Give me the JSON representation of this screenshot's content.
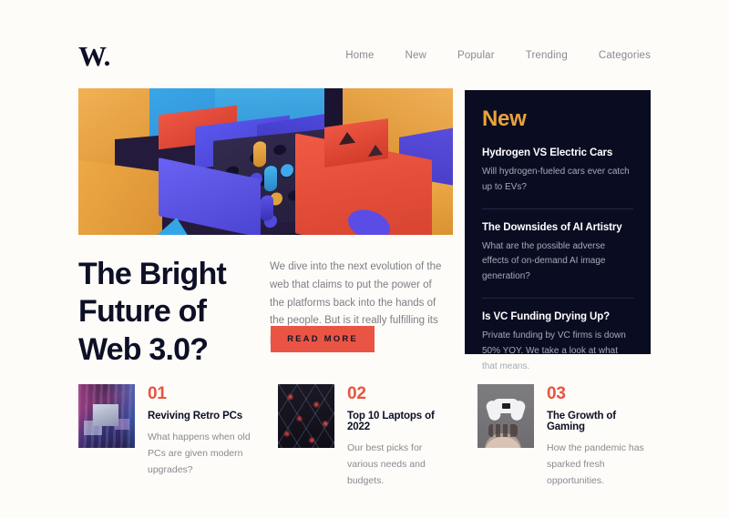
{
  "site": {
    "logo": "W.",
    "background_color": "#FDFCF8",
    "accent_red": "#E8533F",
    "accent_amber": "#E9A23C",
    "ink": "#0D1026"
  },
  "nav": {
    "items": [
      {
        "label": "Home"
      },
      {
        "label": "New"
      },
      {
        "label": "Popular"
      },
      {
        "label": "Trending"
      },
      {
        "label": "Categories"
      }
    ]
  },
  "hero": {
    "image_alt": "3D render of colorful geometric blocks with a dark pegboard",
    "title": "The Bright Future of Web 3.0?",
    "body": "We dive into the next evolution of the web that claims to put the power of the platforms back into the hands of the people. But is it really fulfilling its promise?",
    "cta_label": "Read More"
  },
  "new_panel": {
    "title": "New",
    "items": [
      {
        "title": "Hydrogen VS Electric Cars",
        "desc": "Will hydrogen-fueled cars ever catch up to EVs?"
      },
      {
        "title": "The Downsides of AI Artistry",
        "desc": "What are the possible adverse effects of on-demand AI image generation?"
      },
      {
        "title": "Is VC Funding Drying Up?",
        "desc": "Private funding by VC firms is down 50% YOY. We take a look at what that means."
      }
    ]
  },
  "cards": [
    {
      "number": "01",
      "title": "Reviving Retro PCs",
      "desc": "What happens when old PCs are given modern upgrades?",
      "thumb_alt": "Retro computers lit by pink and blue neon"
    },
    {
      "number": "02",
      "title": "Top 10 Laptops of 2022",
      "desc": "Our best picks for various needs and budgets.",
      "thumb_alt": "Dark diamond lattice pattern with red lights"
    },
    {
      "number": "03",
      "title": "The Growth of Gaming",
      "desc": "How the pandemic has sparked fresh opportunities.",
      "thumb_alt": "White game controller floating above an open hand"
    }
  ]
}
